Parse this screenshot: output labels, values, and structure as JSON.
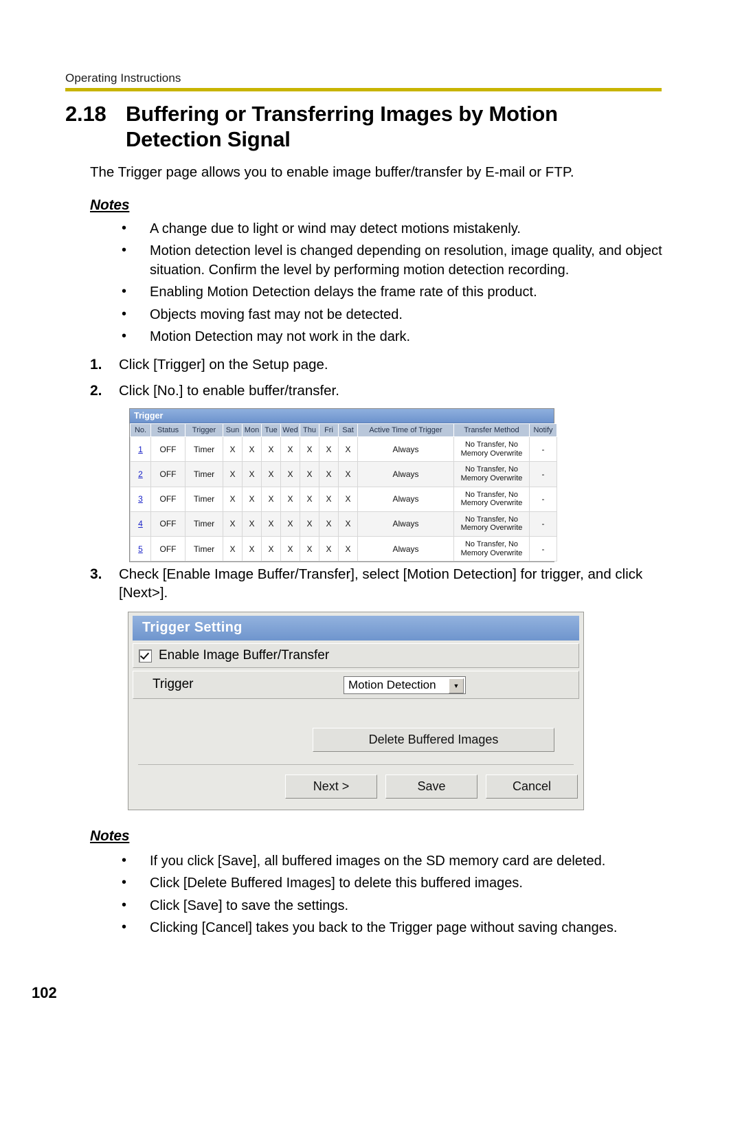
{
  "header": {
    "running_head": "Operating Instructions",
    "rule_color": "#c8b400"
  },
  "title": {
    "number": "2.18",
    "text": "Buffering or Transferring Images by Motion Detection Signal"
  },
  "intro": "The Trigger page allows you to enable image buffer/transfer by E-mail or FTP.",
  "notes_1": {
    "heading": "Notes",
    "items": [
      "A change due to light or wind may detect motions mistakenly.",
      "Motion detection level is changed depending on resolution, image quality, and object situation. Confirm the level by performing motion detection recording.",
      "Enabling Motion Detection delays the frame rate of this product.",
      "Objects moving fast may not be detected.",
      "Motion Detection may not work in the dark."
    ]
  },
  "steps": [
    {
      "number": "1.",
      "text": "Click [Trigger] on the Setup page."
    },
    {
      "number": "2.",
      "text": "Click [No.] to enable buffer/transfer."
    },
    {
      "number": "3.",
      "text": "Check [Enable Image Buffer/Transfer], select [Motion Detection] for trigger, and click [Next>]."
    }
  ],
  "trigger_screenshot": {
    "title": "Trigger",
    "columns": [
      "No.",
      "Status",
      "Trigger",
      "Sun",
      "Mon",
      "Tue",
      "Wed",
      "Thu",
      "Fri",
      "Sat",
      "Active Time of Trigger",
      "Transfer Method",
      "Notify"
    ],
    "rows": [
      {
        "no": "1",
        "status": "OFF",
        "trigger": "Timer",
        "days": [
          "X",
          "X",
          "X",
          "X",
          "X",
          "X",
          "X"
        ],
        "active_time": "Always",
        "method": "No Transfer, No Memory Overwrite",
        "notify": "-"
      },
      {
        "no": "2",
        "status": "OFF",
        "trigger": "Timer",
        "days": [
          "X",
          "X",
          "X",
          "X",
          "X",
          "X",
          "X"
        ],
        "active_time": "Always",
        "method": "No Transfer, No Memory Overwrite",
        "notify": "-"
      },
      {
        "no": "3",
        "status": "OFF",
        "trigger": "Timer",
        "days": [
          "X",
          "X",
          "X",
          "X",
          "X",
          "X",
          "X"
        ],
        "active_time": "Always",
        "method": "No Transfer, No Memory Overwrite",
        "notify": "-"
      },
      {
        "no": "4",
        "status": "OFF",
        "trigger": "Timer",
        "days": [
          "X",
          "X",
          "X",
          "X",
          "X",
          "X",
          "X"
        ],
        "active_time": "Always",
        "method": "No Transfer, No Memory Overwrite",
        "notify": "-"
      },
      {
        "no": "5",
        "status": "OFF",
        "trigger": "Timer",
        "days": [
          "X",
          "X",
          "X",
          "X",
          "X",
          "X",
          "X"
        ],
        "active_time": "Always",
        "method": "No Transfer, No Memory Overwrite",
        "notify": "-"
      }
    ]
  },
  "setting_screenshot": {
    "title": "Trigger Setting",
    "enable_label": "Enable Image Buffer/Transfer",
    "enable_checked": true,
    "trigger_label": "Trigger",
    "trigger_value": "Motion Detection",
    "delete_button": "Delete Buffered Images",
    "next_button": "Next >",
    "save_button": "Save",
    "cancel_button": "Cancel"
  },
  "notes_2": {
    "heading": "Notes",
    "items": [
      "If you click [Save], all buffered images on the SD memory card are deleted.",
      "Click [Delete Buffered Images] to delete this buffered images.",
      "Click [Save] to save the settings.",
      "Clicking [Cancel] takes you back to the Trigger page without saving changes."
    ]
  },
  "page_number": "102"
}
